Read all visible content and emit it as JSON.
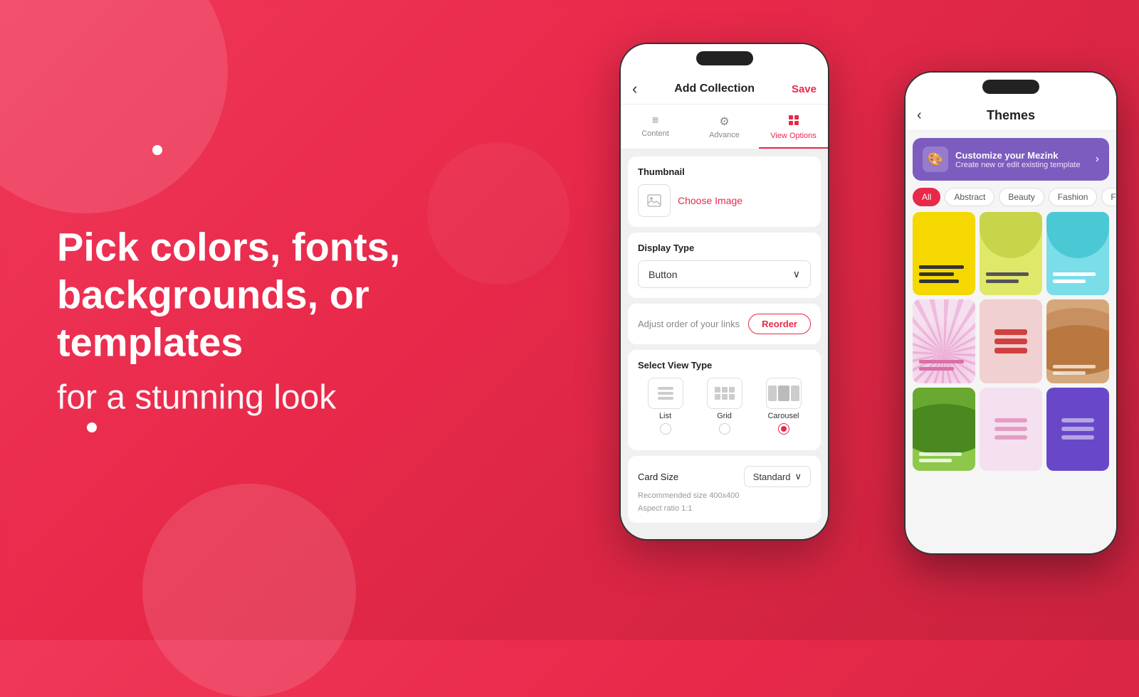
{
  "background": {
    "gradient_start": "#f0385a",
    "gradient_end": "#c8223e"
  },
  "hero": {
    "line1_bold": "Pick colors, fonts,",
    "line2_bold": "backgrounds, or templates",
    "line3_light": "for a stunning look"
  },
  "phone1": {
    "header": {
      "back_label": "‹",
      "title": "Add Collection",
      "save_label": "Save"
    },
    "tabs": [
      {
        "label": "Content",
        "icon": "≡",
        "active": false
      },
      {
        "label": "Advance",
        "icon": "⚙",
        "active": false
      },
      {
        "label": "View Options",
        "icon": "🖼",
        "active": true
      }
    ],
    "thumbnail_section": {
      "title": "Thumbnail",
      "choose_image_label": "Choose Image"
    },
    "display_type_section": {
      "title": "Display Type",
      "value": "Button",
      "chevron": "∨"
    },
    "reorder_section": {
      "text": "Adjust order of your links",
      "button_label": "Reorder"
    },
    "view_type_section": {
      "title": "Select View Type",
      "options": [
        {
          "label": "List",
          "active": false
        },
        {
          "label": "Grid",
          "active": false
        },
        {
          "label": "Carousel",
          "active": true
        }
      ]
    },
    "card_size_section": {
      "title": "Card Size",
      "value": "Standard",
      "chevron": "∨",
      "hint_line1": "Recommended size 400x400",
      "hint_line2": "Aspect ratio 1:1"
    }
  },
  "phone2": {
    "header": {
      "back_label": "‹",
      "title": "Themes"
    },
    "customize_banner": {
      "icon": "🎨",
      "title": "Customize your Mezink",
      "subtitle": "Create new or edit existing template",
      "arrow": "›"
    },
    "filter_chips": [
      {
        "label": "All",
        "active": true
      },
      {
        "label": "Abstract",
        "active": false
      },
      {
        "label": "Beauty",
        "active": false
      },
      {
        "label": "Fashion",
        "active": false
      },
      {
        "label": "Food",
        "active": false
      }
    ],
    "themes": [
      {
        "id": "yellow",
        "style": "yellow"
      },
      {
        "id": "pastel-yellow",
        "style": "pastel-yellow"
      },
      {
        "id": "mint",
        "style": "mint"
      },
      {
        "id": "pink-rays",
        "style": "pink-rays"
      },
      {
        "id": "red-boxes",
        "style": "red-boxes"
      },
      {
        "id": "sandy",
        "style": "sandy"
      },
      {
        "id": "green",
        "style": "green"
      },
      {
        "id": "soft-pink",
        "style": "soft-pink"
      },
      {
        "id": "purple",
        "style": "purple"
      }
    ]
  }
}
